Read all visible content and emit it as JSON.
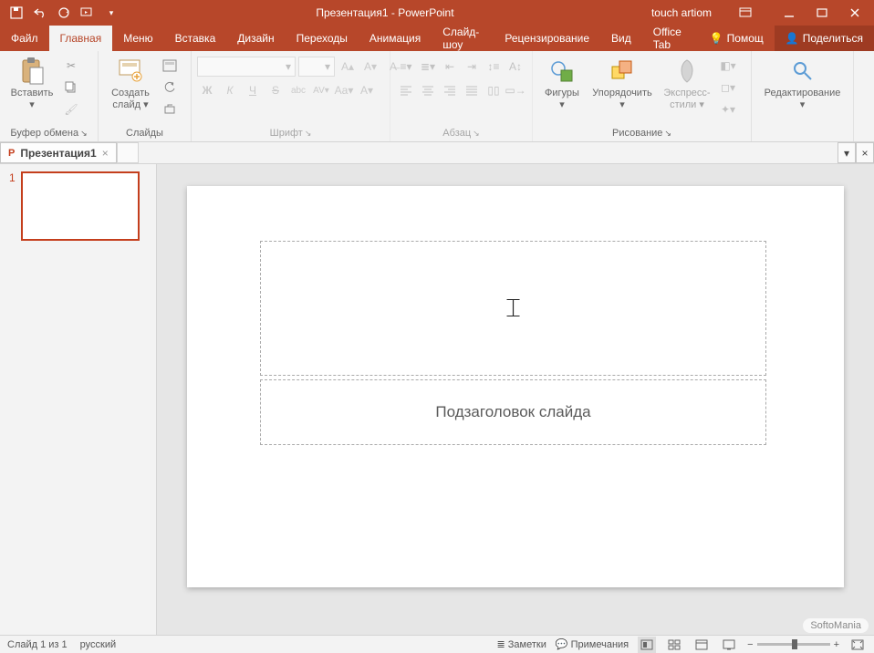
{
  "title": "Презентация1 - PowerPoint",
  "user": "touch artiom",
  "tabs": {
    "file": "Файл",
    "home": "Главная",
    "menu": "Меню",
    "insert": "Вставка",
    "design": "Дизайн",
    "transitions": "Переходы",
    "animations": "Анимация",
    "slideshow": "Слайд-шоу",
    "review": "Рецензирование",
    "view": "Вид",
    "officetab": "Office Tab",
    "help": "Помощ",
    "share": "Поделиться"
  },
  "ribbon": {
    "paste": "Вставить",
    "clipboard_group": "Буфер обмена",
    "new_slide": "Создать слайд",
    "slides_group": "Слайды",
    "font_group": "Шрифт",
    "paragraph_group": "Абзац",
    "shapes": "Фигуры",
    "arrange": "Упорядочить",
    "quick_styles": "Экспресс-стили",
    "drawing_group": "Рисование",
    "editing": "Редактирование"
  },
  "font_buttons": {
    "bold": "Ж",
    "italic": "К",
    "underline": "Ч",
    "strike": "S",
    "shadow": "abc",
    "spacing": "AV",
    "case": "Aa",
    "color": "A",
    "incA": "A",
    "decA": "A"
  },
  "doc_tab": "Презентация1",
  "slide": {
    "subtitle": "Подзаголовок слайда",
    "number": "1"
  },
  "status": {
    "slide_info": "Слайд 1 из 1",
    "lang": "русский",
    "notes": "Заметки",
    "comments": "Примечания"
  },
  "watermark": "SoftoMania"
}
